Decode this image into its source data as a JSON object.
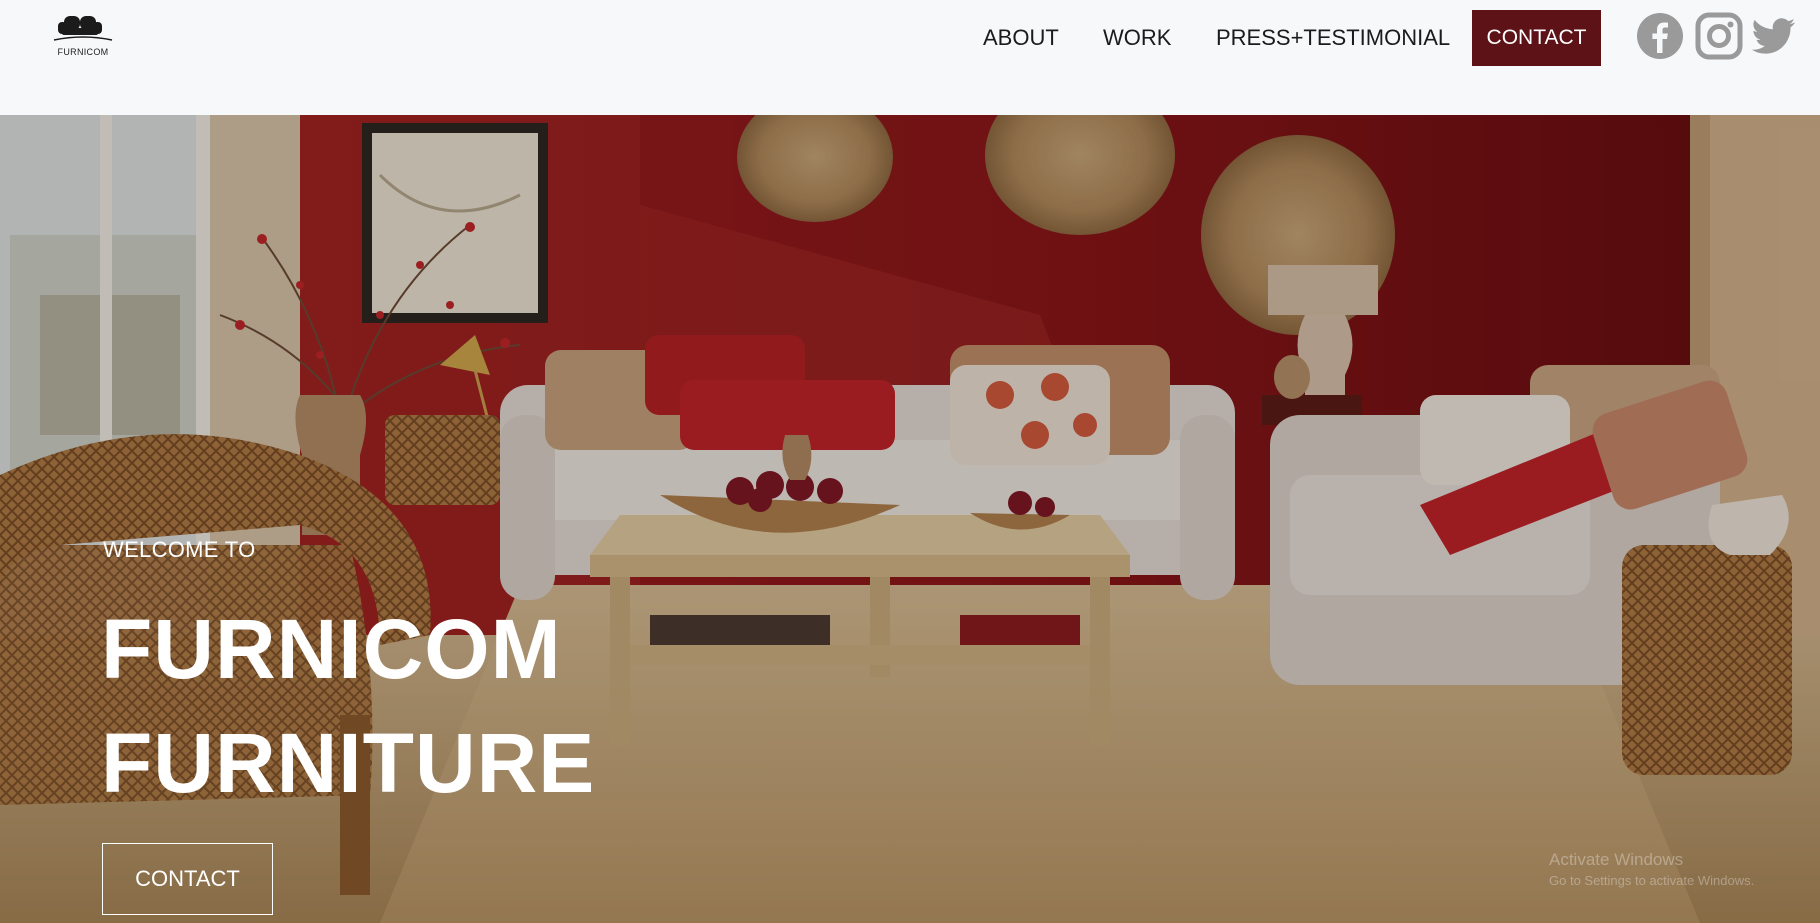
{
  "brand": {
    "logo_text": "FURNICOM"
  },
  "nav": {
    "about": "ABOUT",
    "work": "WORK",
    "press": "PRESS+TESTIMONIAL",
    "contact": "CONTACT"
  },
  "social": [
    "facebook-icon",
    "instagram-icon",
    "twitter-icon"
  ],
  "hero": {
    "welcome": "WELCOME TO",
    "headline_line1": "FURNICOM",
    "headline_line2": "FURNITURE",
    "cta": "CONTACT"
  },
  "os_watermark": {
    "title": "Activate Windows",
    "subtitle": "Go to Settings to activate Windows."
  },
  "colors": {
    "accent": "#5d1217",
    "header_bg": "#f7f8fa",
    "icon_gray": "#9a9a9a"
  }
}
